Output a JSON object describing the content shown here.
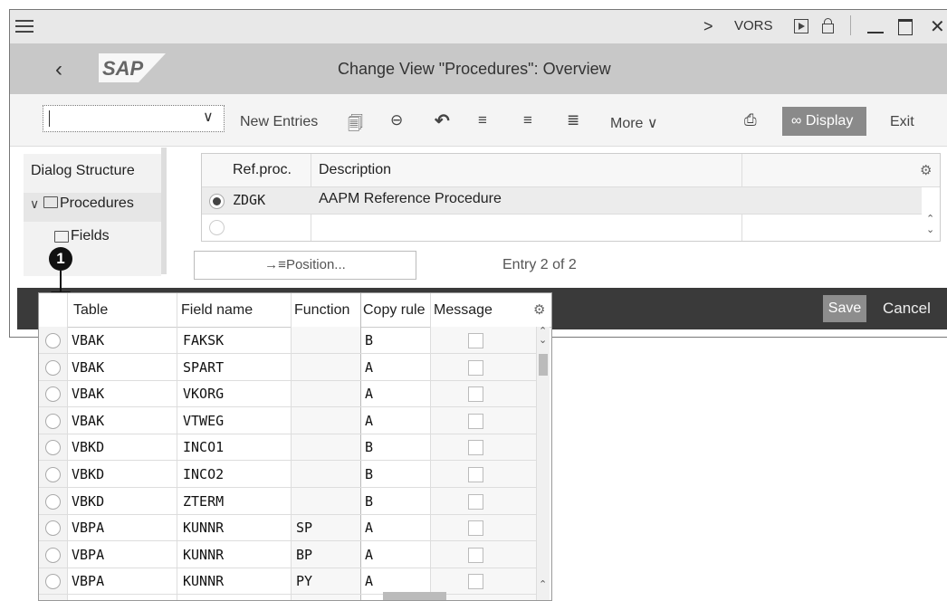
{
  "titlebar": {
    "menu_icon": "hamburger-icon",
    "chevron": ">",
    "system": "VORS"
  },
  "header": {
    "logo": "SAP",
    "title": "Change View \"Procedures\": Overview"
  },
  "toolbar": {
    "command_value": "",
    "new_entries": "New Entries",
    "more": "More",
    "display": "Display",
    "exit": "Exit"
  },
  "dialog_structure": {
    "title": "Dialog Structure",
    "items": [
      {
        "label": "Procedures",
        "icon": "open-folder-icon"
      },
      {
        "label": "Fields",
        "icon": "folder-icon"
      }
    ]
  },
  "procedures": {
    "columns": [
      "Ref.proc.",
      "Description"
    ],
    "rows": [
      {
        "ref": "ZDGK",
        "description": "AAPM Reference Procedure",
        "selected": true
      },
      {
        "ref": "",
        "description": "",
        "selected": false
      }
    ]
  },
  "position_button": "Position...",
  "entry_info": "Entry 2 of 2",
  "footer": {
    "save": "Save",
    "cancel": "Cancel"
  },
  "callout": "1",
  "fields_table": {
    "columns": [
      "Table",
      "Field name",
      "Function",
      "Copy rule",
      "Message"
    ],
    "rows": [
      {
        "table": "VBAK",
        "field": "FAKSK",
        "function": "",
        "copy_rule": "B"
      },
      {
        "table": "VBAK",
        "field": "SPART",
        "function": "",
        "copy_rule": "A"
      },
      {
        "table": "VBAK",
        "field": "VKORG",
        "function": "",
        "copy_rule": "A"
      },
      {
        "table": "VBAK",
        "field": "VTWEG",
        "function": "",
        "copy_rule": "A"
      },
      {
        "table": "VBKD",
        "field": "INCO1",
        "function": "",
        "copy_rule": "B"
      },
      {
        "table": "VBKD",
        "field": "INCO2",
        "function": "",
        "copy_rule": "B"
      },
      {
        "table": "VBKD",
        "field": "ZTERM",
        "function": "",
        "copy_rule": "B"
      },
      {
        "table": "VBPA",
        "field": "KUNNR",
        "function": "SP",
        "copy_rule": "A"
      },
      {
        "table": "VBPA",
        "field": "KUNNR",
        "function": "BP",
        "copy_rule": "A"
      },
      {
        "table": "VBPA",
        "field": "KUNNR",
        "function": "PY",
        "copy_rule": "A"
      }
    ]
  }
}
